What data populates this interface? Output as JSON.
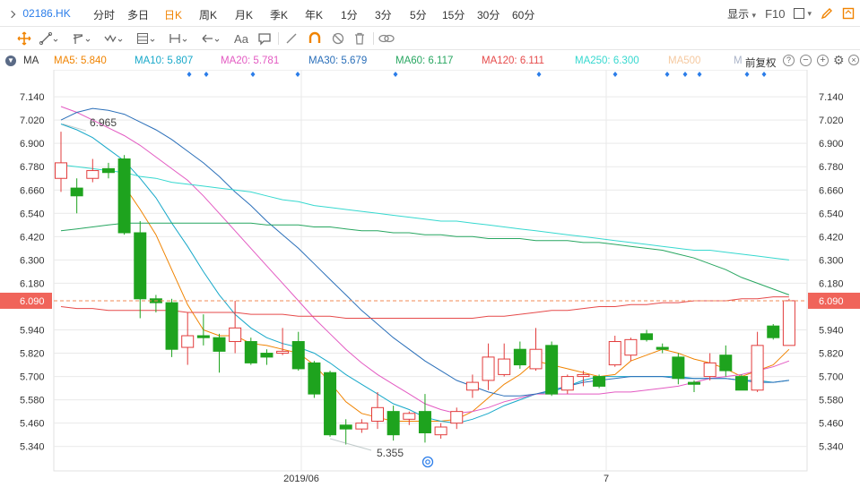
{
  "header": {
    "symbol": "02186.HK",
    "period_tabs": [
      {
        "label": "分时",
        "active": false
      },
      {
        "label": "多日",
        "active": false
      },
      {
        "label": "日K",
        "active": true
      },
      {
        "label": "周K",
        "active": false
      },
      {
        "label": "月K",
        "active": false
      },
      {
        "label": "季K",
        "active": false
      },
      {
        "label": "年K",
        "active": false
      },
      {
        "label": "1分",
        "active": false
      },
      {
        "label": "3分",
        "active": false
      },
      {
        "label": "5分",
        "active": false
      },
      {
        "label": "15分",
        "active": false
      },
      {
        "label": "30分",
        "active": false
      },
      {
        "label": "60分",
        "active": false
      }
    ],
    "display_label": "显示",
    "f10_label": "F10"
  },
  "toolbar": {
    "font_tool_label": "Aa",
    "icons": [
      "crosshair-icon",
      "line-tool-icon",
      "channel-tool-icon",
      "wave-tool-icon",
      "fibonacci-tool-icon",
      "range-tool-icon",
      "arrow-tool-icon",
      "text-tool-icon",
      "comment-tool-icon",
      "pen-icon",
      "magnet-icon",
      "hide-icon",
      "trash-icon",
      "link-icon"
    ]
  },
  "ma_bar": {
    "label": "MA",
    "items": [
      {
        "text": "MA5: 5.840",
        "color": "#f08300"
      },
      {
        "text": "MA10: 5.807",
        "color": "#17a8c9"
      },
      {
        "text": "MA20: 5.781",
        "color": "#e35ac2"
      },
      {
        "text": "MA30: 5.679",
        "color": "#2a6fb9"
      },
      {
        "text": "MA60: 6.117",
        "color": "#27a660"
      },
      {
        "text": "MA120: 6.111",
        "color": "#e64a4a"
      },
      {
        "text": "MA250: 6.300",
        "color": "#36d8cf"
      },
      {
        "text": "MA500",
        "color": "#f5c9a0"
      },
      {
        "text": "M",
        "color": "#aab4c8"
      }
    ],
    "adjust_label": "前复权"
  },
  "chart_data": {
    "type": "candlestick",
    "y_ticks": [
      "7.140",
      "7.020",
      "6.900",
      "6.780",
      "6.660",
      "6.540",
      "6.420",
      "6.300",
      "6.180",
      "6.090",
      "5.940",
      "5.820",
      "5.700",
      "5.580",
      "5.460",
      "5.340"
    ],
    "ylim": [
      5.28,
      7.2
    ],
    "x_labels": [
      "2019/06",
      "7"
    ],
    "current_price": "6.090",
    "annotations": {
      "high": "6.965",
      "low": "5.355"
    },
    "colors": {
      "up": "#e23c3c",
      "down": "#1ea31e",
      "grid": "#e9e9e9",
      "axis_text": "#333333",
      "price_line": "#f08a55",
      "price_badge": "#f0645a"
    },
    "candles": [
      {
        "o": 6.72,
        "h": 6.96,
        "l": 6.65,
        "c": 6.8
      },
      {
        "o": 6.67,
        "h": 6.72,
        "l": 6.54,
        "c": 6.63
      },
      {
        "o": 6.72,
        "h": 6.82,
        "l": 6.7,
        "c": 6.76
      },
      {
        "o": 6.77,
        "h": 6.8,
        "l": 6.72,
        "c": 6.75
      },
      {
        "o": 6.82,
        "h": 6.84,
        "l": 6.43,
        "c": 6.44
      },
      {
        "o": 6.44,
        "h": 6.5,
        "l": 6.0,
        "c": 6.1
      },
      {
        "o": 6.1,
        "h": 6.12,
        "l": 6.03,
        "c": 6.08
      },
      {
        "o": 6.08,
        "h": 6.1,
        "l": 5.8,
        "c": 5.84
      },
      {
        "o": 5.85,
        "h": 6.03,
        "l": 5.76,
        "c": 5.91
      },
      {
        "o": 5.91,
        "h": 6.02,
        "l": 5.86,
        "c": 5.9
      },
      {
        "o": 5.9,
        "h": 5.92,
        "l": 5.72,
        "c": 5.83
      },
      {
        "o": 5.88,
        "h": 6.09,
        "l": 5.82,
        "c": 5.95
      },
      {
        "o": 5.88,
        "h": 5.9,
        "l": 5.76,
        "c": 5.77
      },
      {
        "o": 5.82,
        "h": 5.84,
        "l": 5.76,
        "c": 5.8
      },
      {
        "o": 5.82,
        "h": 5.95,
        "l": 5.81,
        "c": 5.83
      },
      {
        "o": 5.88,
        "h": 5.93,
        "l": 5.73,
        "c": 5.74
      },
      {
        "o": 5.77,
        "h": 5.78,
        "l": 5.59,
        "c": 5.61
      },
      {
        "o": 5.72,
        "h": 5.73,
        "l": 5.39,
        "c": 5.4
      },
      {
        "o": 5.45,
        "h": 5.48,
        "l": 5.35,
        "c": 5.43
      },
      {
        "o": 5.43,
        "h": 5.48,
        "l": 5.41,
        "c": 5.46
      },
      {
        "o": 5.47,
        "h": 5.62,
        "l": 5.43,
        "c": 5.54
      },
      {
        "o": 5.52,
        "h": 5.55,
        "l": 5.37,
        "c": 5.4
      },
      {
        "o": 5.48,
        "h": 5.52,
        "l": 5.45,
        "c": 5.51
      },
      {
        "o": 5.52,
        "h": 5.61,
        "l": 5.36,
        "c": 5.41
      },
      {
        "o": 5.4,
        "h": 5.46,
        "l": 5.38,
        "c": 5.44
      },
      {
        "o": 5.46,
        "h": 5.54,
        "l": 5.43,
        "c": 5.52
      },
      {
        "o": 5.63,
        "h": 5.71,
        "l": 5.59,
        "c": 5.67
      },
      {
        "o": 5.68,
        "h": 5.87,
        "l": 5.63,
        "c": 5.8
      },
      {
        "o": 5.71,
        "h": 5.87,
        "l": 5.7,
        "c": 5.79
      },
      {
        "o": 5.84,
        "h": 5.88,
        "l": 5.74,
        "c": 5.76
      },
      {
        "o": 5.74,
        "h": 5.95,
        "l": 5.73,
        "c": 5.84
      },
      {
        "o": 5.86,
        "h": 5.88,
        "l": 5.6,
        "c": 5.61
      },
      {
        "o": 5.63,
        "h": 5.71,
        "l": 5.61,
        "c": 5.7
      },
      {
        "o": 5.7,
        "h": 5.73,
        "l": 5.65,
        "c": 5.71
      },
      {
        "o": 5.7,
        "h": 5.71,
        "l": 5.64,
        "c": 5.65
      },
      {
        "o": 5.76,
        "h": 5.91,
        "l": 5.75,
        "c": 5.88
      },
      {
        "o": 5.81,
        "h": 5.9,
        "l": 5.78,
        "c": 5.89
      },
      {
        "o": 5.92,
        "h": 5.94,
        "l": 5.88,
        "c": 5.89
      },
      {
        "o": 5.85,
        "h": 5.87,
        "l": 5.82,
        "c": 5.84
      },
      {
        "o": 5.8,
        "h": 5.82,
        "l": 5.66,
        "c": 5.69
      },
      {
        "o": 5.67,
        "h": 5.68,
        "l": 5.62,
        "c": 5.66
      },
      {
        "o": 5.7,
        "h": 5.82,
        "l": 5.68,
        "c": 5.77
      },
      {
        "o": 5.81,
        "h": 5.86,
        "l": 5.7,
        "c": 5.73
      },
      {
        "o": 5.7,
        "h": 5.71,
        "l": 5.63,
        "c": 5.63
      },
      {
        "o": 5.63,
        "h": 5.93,
        "l": 5.62,
        "c": 5.86
      },
      {
        "o": 5.96,
        "h": 5.97,
        "l": 5.89,
        "c": 5.9
      },
      {
        "o": 5.86,
        "h": 6.1,
        "l": 5.86,
        "c": 6.09
      }
    ],
    "ma_lines": [
      {
        "name": "MA5",
        "color": "#f08300",
        "values": [
          null,
          null,
          null,
          null,
          6.68,
          6.56,
          6.43,
          6.25,
          6.07,
          5.94,
          5.91,
          5.91,
          5.87,
          5.86,
          5.84,
          5.82,
          5.76,
          5.67,
          5.57,
          5.51,
          5.49,
          5.47,
          5.47,
          5.47,
          5.47,
          5.48,
          5.52,
          5.59,
          5.66,
          5.71,
          5.78,
          5.76,
          5.74,
          5.72,
          5.7,
          5.71,
          5.78,
          5.81,
          5.84,
          5.82,
          5.79,
          5.77,
          5.74,
          5.7,
          5.73,
          5.76,
          5.84
        ]
      },
      {
        "name": "MA10",
        "color": "#17a8c9",
        "values": [
          7.0,
          6.97,
          6.93,
          6.87,
          6.81,
          6.72,
          6.62,
          6.49,
          6.37,
          6.24,
          6.12,
          6.02,
          5.95,
          5.9,
          5.87,
          5.85,
          5.82,
          5.77,
          5.71,
          5.66,
          5.61,
          5.56,
          5.53,
          5.49,
          5.47,
          5.46,
          5.48,
          5.51,
          5.55,
          5.58,
          5.61,
          5.62,
          5.65,
          5.68,
          5.7,
          5.7,
          5.7,
          5.7,
          5.7,
          5.7,
          5.69,
          5.69,
          5.69,
          5.68,
          5.68,
          5.67,
          5.68
        ]
      },
      {
        "name": "MA20",
        "color": "#e35ac2",
        "values": [
          7.09,
          7.06,
          7.02,
          6.98,
          6.94,
          6.89,
          6.83,
          6.77,
          6.71,
          6.63,
          6.54,
          6.45,
          6.36,
          6.27,
          6.18,
          6.09,
          6.0,
          5.92,
          5.84,
          5.77,
          5.71,
          5.66,
          5.61,
          5.56,
          5.53,
          5.51,
          5.52,
          5.54,
          5.57,
          5.59,
          5.61,
          5.61,
          5.61,
          5.61,
          5.61,
          5.62,
          5.62,
          5.63,
          5.64,
          5.65,
          5.67,
          5.69,
          5.7,
          5.71,
          5.73,
          5.75,
          5.78
        ]
      },
      {
        "name": "MA30",
        "color": "#2a6fb9",
        "values": [
          7.02,
          7.06,
          7.08,
          7.07,
          7.05,
          7.01,
          6.97,
          6.92,
          6.86,
          6.8,
          6.73,
          6.65,
          6.58,
          6.5,
          6.43,
          6.36,
          6.28,
          6.2,
          6.12,
          6.04,
          5.97,
          5.9,
          5.84,
          5.78,
          5.73,
          5.68,
          5.65,
          5.62,
          5.6,
          5.6,
          5.61,
          5.63,
          5.65,
          5.67,
          5.68,
          5.69,
          5.7,
          5.7,
          5.7,
          5.69,
          5.69,
          5.69,
          5.69,
          5.68,
          5.67,
          5.67,
          5.68
        ]
      },
      {
        "name": "MA60",
        "color": "#27a660",
        "values": [
          6.45,
          6.46,
          6.47,
          6.48,
          6.49,
          6.49,
          6.49,
          6.49,
          6.49,
          6.49,
          6.49,
          6.49,
          6.49,
          6.48,
          6.48,
          6.48,
          6.47,
          6.47,
          6.46,
          6.45,
          6.45,
          6.44,
          6.44,
          6.43,
          6.43,
          6.42,
          6.42,
          6.41,
          6.41,
          6.41,
          6.4,
          6.4,
          6.4,
          6.39,
          6.39,
          6.38,
          6.37,
          6.36,
          6.35,
          6.33,
          6.31,
          6.28,
          6.25,
          6.21,
          6.18,
          6.15,
          6.12
        ]
      },
      {
        "name": "MA120",
        "color": "#e64a4a",
        "values": [
          6.06,
          6.05,
          6.05,
          6.04,
          6.04,
          6.04,
          6.04,
          6.04,
          6.03,
          6.03,
          6.03,
          6.03,
          6.02,
          6.02,
          6.02,
          6.01,
          6.01,
          6.01,
          6.0,
          6.0,
          6.0,
          6.0,
          6.0,
          6.0,
          6.0,
          6.0,
          6.0,
          6.01,
          6.01,
          6.02,
          6.03,
          6.04,
          6.04,
          6.05,
          6.06,
          6.06,
          6.07,
          6.07,
          6.08,
          6.08,
          6.09,
          6.09,
          6.09,
          6.1,
          6.1,
          6.11,
          6.11
        ]
      },
      {
        "name": "MA250",
        "color": "#36d8cf",
        "values": [
          6.79,
          6.78,
          6.77,
          6.76,
          6.75,
          6.73,
          6.72,
          6.7,
          6.69,
          6.68,
          6.67,
          6.66,
          6.65,
          6.63,
          6.61,
          6.6,
          6.58,
          6.57,
          6.56,
          6.55,
          6.54,
          6.53,
          6.52,
          6.51,
          6.5,
          6.5,
          6.49,
          6.48,
          6.47,
          6.46,
          6.45,
          6.44,
          6.43,
          6.42,
          6.41,
          6.4,
          6.39,
          6.38,
          6.37,
          6.36,
          6.35,
          6.35,
          6.34,
          6.33,
          6.32,
          6.31,
          6.3
        ]
      }
    ]
  }
}
